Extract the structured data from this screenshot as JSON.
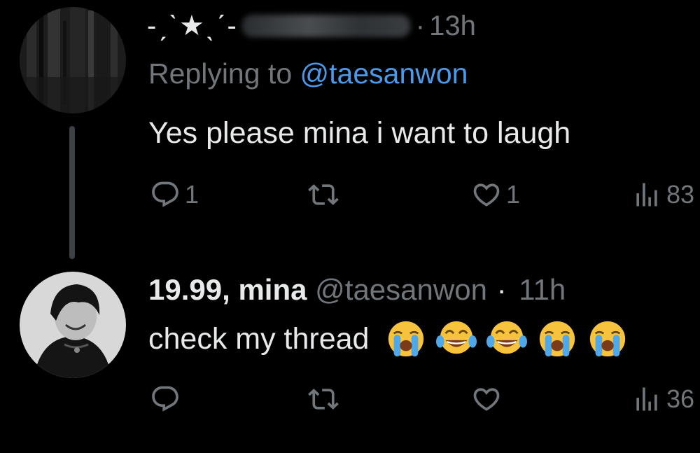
{
  "tweets": [
    {
      "header_deco": "-ˏˋ★ˎˊ-",
      "time": "13h",
      "replying_prefix": "Replying to",
      "replying_handle": "@taesanwon",
      "text": "Yes please mina i want to laugh",
      "actions": {
        "replies": "1",
        "reposts": "",
        "likes": "1",
        "views": "83"
      }
    },
    {
      "name": "19.99, mina",
      "handle": "@taesanwon",
      "time": "11h",
      "text": "check my thread",
      "emojis": [
        "loudly-crying-face",
        "face-with-tears-of-joy",
        "face-with-tears-of-joy",
        "loudly-crying-face",
        "loudly-crying-face"
      ],
      "actions": {
        "replies": "",
        "reposts": "",
        "likes": "",
        "views": "36"
      }
    }
  ],
  "separator": "·",
  "colors": {
    "background": "#000000",
    "text": "#e7e9ea",
    "muted": "#71767b",
    "link": "#4a9ae9",
    "thread_line": "#3d4145"
  }
}
